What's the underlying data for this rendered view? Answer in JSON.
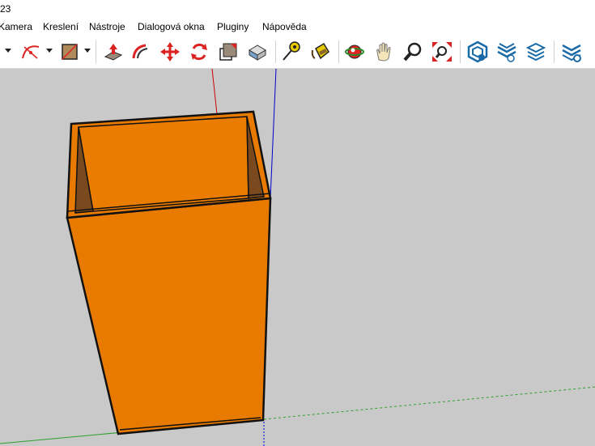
{
  "window": {
    "title_fragment": "23"
  },
  "menu": {
    "items": [
      "Kamera",
      "Kreslení",
      "Nástroje",
      "Dialogová okna",
      "Pluginy",
      "Nápověda"
    ]
  },
  "toolbar": {
    "tools": [
      "eraser-tool",
      "arc-tool",
      "shape-tool",
      "push-pull-tool",
      "follow-me-tool",
      "move-tool",
      "rotate-tool",
      "scale-tool",
      "offset-tool",
      "tape-measure-tool",
      "paint-bucket-tool",
      "orbit-tool",
      "pan-tool",
      "zoom-tool",
      "zoom-extents-tool",
      "warehouse-tool",
      "extension-warehouse-tool",
      "layout-tool",
      "extension-manager-tool"
    ]
  },
  "colors": {
    "box_face": "#e87a00",
    "box_inner": "#8a4f1a",
    "axis_red": "#cc0000",
    "axis_blue": "#0000cc",
    "axis_green": "#2ea02e",
    "background": "#c9c9c9"
  }
}
